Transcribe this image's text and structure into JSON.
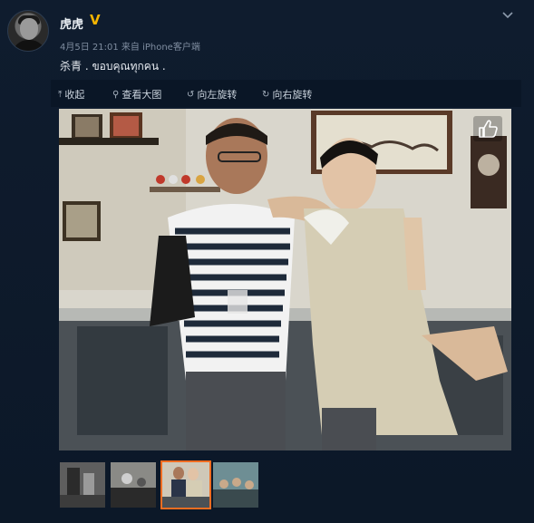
{
  "post": {
    "username": "虎虎",
    "verified_icon": "verified-v-icon",
    "meta": "4月5日 21:01 来自 iPhone客户端",
    "text": "杀青 . ขอบคุณทุกคน ."
  },
  "toolbar": {
    "collapse": "收起",
    "view_large": "查看大图",
    "rotate_left": "向左旋转",
    "rotate_right": "向右旋转"
  },
  "thumbnails": [
    {
      "name": "thumbnail-1",
      "selected": false
    },
    {
      "name": "thumbnail-2",
      "selected": false
    },
    {
      "name": "thumbnail-3",
      "selected": true
    },
    {
      "name": "thumbnail-4",
      "selected": false
    }
  ],
  "colors": {
    "background": "#0d1a2b",
    "verified": "#f5b400",
    "selected_border": "#f36d21"
  }
}
